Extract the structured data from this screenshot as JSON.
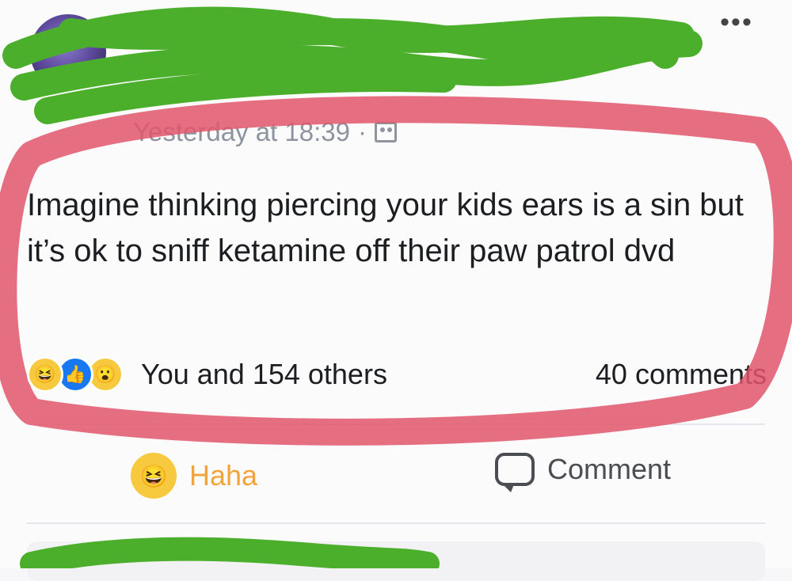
{
  "post": {
    "author_name": "",
    "timestamp": "Yesterday at 18:39",
    "timestamp_separator": "·",
    "audience_icon": "friends-icon",
    "more_label": "•••",
    "text": "Imagine thinking piercing your kids ears is a sin but it’s ok to sniff ketamine off their paw patrol dvd"
  },
  "reactions": {
    "icons": [
      "haha",
      "like",
      "wow"
    ],
    "summary": "You and 154 others",
    "comments": "40 comments"
  },
  "actions": {
    "reaction_label": "Haha",
    "comment_label": "Comment"
  },
  "colors": {
    "haha_orange": "#f2a33a",
    "like_blue": "#1877f2",
    "redaction_green": "#4caf2c",
    "highlight_red": "#e0566b"
  }
}
